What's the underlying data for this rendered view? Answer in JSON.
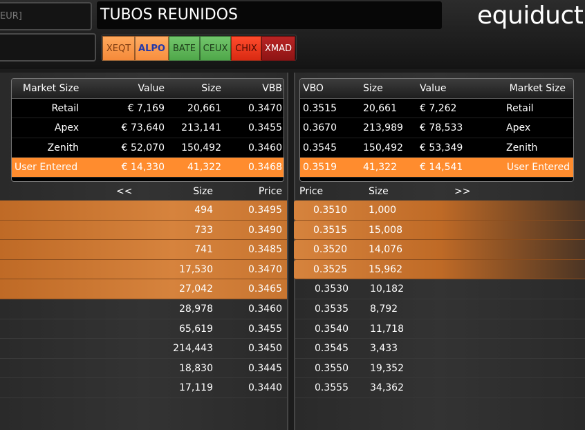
{
  "header": {
    "symbol_input": "EUR]",
    "second_input": "",
    "instrument_title": "TUBOS REUNIDOS",
    "logo": "equiduct"
  },
  "venues": [
    {
      "label": "XEQT",
      "color": "#f58a3a"
    },
    {
      "label": "ALPO",
      "color": "#f88e3e"
    },
    {
      "label": "BATE",
      "color": "#4fa74a"
    },
    {
      "label": "CEUX",
      "color": "#4fa74a"
    },
    {
      "label": "CHIX",
      "color": "#d92a12"
    },
    {
      "label": "XMAD",
      "color": "#8e1414"
    }
  ],
  "bid_summary": {
    "headers": {
      "market_size": "Market Size",
      "value": "Value",
      "size": "Size",
      "vbb": "VBB"
    },
    "rows": [
      {
        "market_size": "Retail",
        "value": "€ 7,169",
        "size": "20,661",
        "vbb": "0.3470"
      },
      {
        "market_size": "Apex",
        "value": "€ 73,640",
        "size": "213,141",
        "vbb": "0.3455"
      },
      {
        "market_size": "Zenith",
        "value": "€ 52,070",
        "size": "150,492",
        "vbb": "0.3460"
      },
      {
        "market_size": "User Entered",
        "value": "€ 14,330",
        "size": "41,322",
        "vbb": "0.3468"
      }
    ]
  },
  "ask_summary": {
    "headers": {
      "vbo": "VBO",
      "size": "Size",
      "value": "Value",
      "market_size": "Market Size"
    },
    "rows": [
      {
        "vbo": "0.3515",
        "size": "20,661",
        "value": "€ 7,262",
        "market_size": "Retail"
      },
      {
        "vbo": "0.3670",
        "size": "213,989",
        "value": "€ 78,533",
        "market_size": "Apex"
      },
      {
        "vbo": "0.3545",
        "size": "150,492",
        "value": "€ 53,349",
        "market_size": "Zenith"
      },
      {
        "vbo": "0.3519",
        "size": "41,322",
        "value": "€ 14,541",
        "market_size": "User Entered"
      }
    ]
  },
  "bid_ladder": {
    "nav": "<<",
    "size_label": "Size",
    "price_label": "Price",
    "rows": [
      {
        "size": "494",
        "price": "0.3495"
      },
      {
        "size": "733",
        "price": "0.3490"
      },
      {
        "size": "741",
        "price": "0.3485"
      },
      {
        "size": "17,530",
        "price": "0.3470"
      },
      {
        "size": "27,042",
        "price": "0.3465"
      },
      {
        "size": "28,978",
        "price": "0.3460"
      },
      {
        "size": "65,619",
        "price": "0.3455"
      },
      {
        "size": "214,443",
        "price": "0.3450"
      },
      {
        "size": "18,830",
        "price": "0.3445"
      },
      {
        "size": "17,119",
        "price": "0.3440"
      }
    ]
  },
  "ask_ladder": {
    "nav": ">>",
    "price_label": "Price",
    "size_label": "Size",
    "rows": [
      {
        "price": "0.3510",
        "size": "1,000"
      },
      {
        "price": "0.3515",
        "size": "15,008"
      },
      {
        "price": "0.3520",
        "size": "14,076"
      },
      {
        "price": "0.3525",
        "size": "15,962"
      },
      {
        "price": "0.3530",
        "size": "10,182"
      },
      {
        "price": "0.3535",
        "size": "8,792"
      },
      {
        "price": "0.3540",
        "size": "11,718"
      },
      {
        "price": "0.3545",
        "size": "3,433"
      },
      {
        "price": "0.3550",
        "size": "19,352"
      },
      {
        "price": "0.3555",
        "size": "34,362"
      }
    ]
  }
}
